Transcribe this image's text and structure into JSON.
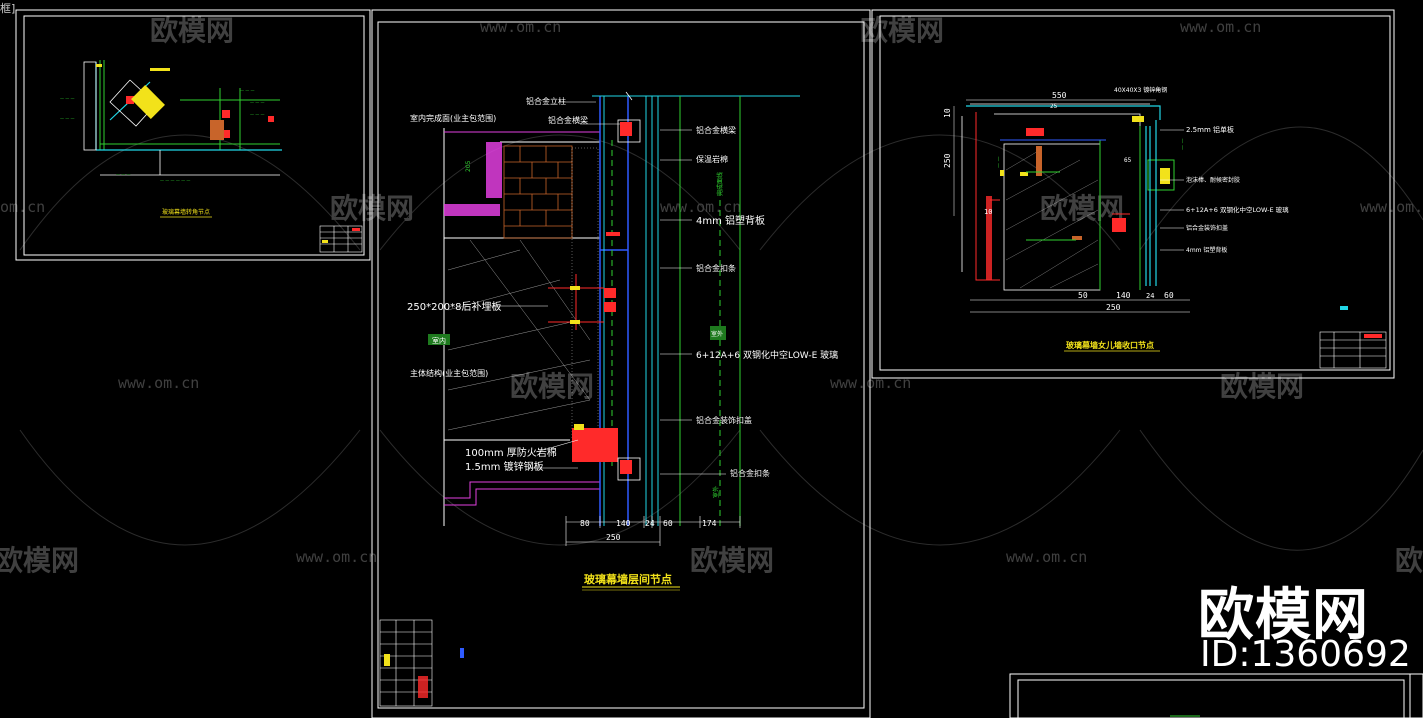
{
  "corner_tag": "框]",
  "watermark": {
    "brand": "欧模网",
    "url": "www.om.cn",
    "url_fragment": "om.cn",
    "big_brand": "欧模网",
    "big_id": "ID:1360692"
  },
  "colors": {
    "background": "#000000",
    "frame": "#ffffff",
    "yellow": "#f2e21a",
    "green": "#2fd12f",
    "cyan": "#21d6e6",
    "magenta": "#e23fe0",
    "red": "#ff2a2a",
    "orange": "#c8642a",
    "blue": "#2f5bff"
  },
  "sheet_left": {
    "title": "玻璃幕墙转角节点"
  },
  "sheet_center": {
    "title": "玻璃幕墙层间节点",
    "labels": {
      "aluminum_mullion": "铝合金立柱",
      "interior_ceiling": "室内完成面(业主包范围)",
      "aluminum_beam": "铝合金横梁",
      "aluminum_bracket": "铝合金横梁",
      "insulation_rock": "保温岩棉",
      "steel_sheet_4mm": "4mm 铝塑背板",
      "aluminum_profile": "铝合金扣条",
      "embed_plate": "250*200*8后补埋板",
      "indoor": "室内",
      "glass": "6+12A+6 双钢化中空LOW-E 玻璃",
      "main_structure": "主体结构(业主包范围)",
      "aluminum_cover": "铝合金装饰扣盖",
      "fire_rock": "100mm 厚防火岩棉",
      "steel_sheet_15": "1.5mm 镀锌钢板",
      "aluminum_trim": "铝合金扣条",
      "outdoor": "室外",
      "outdoor2": "室外",
      "finish": "完成面线",
      "dim_205": "205"
    },
    "dims": [
      "80",
      "140",
      "24",
      "60",
      "174",
      "250"
    ]
  },
  "sheet_right": {
    "title": "玻璃幕墙女儿墙收口节点",
    "labels": {
      "angle_steel": "40X40X3 镀锌角钢",
      "sheet_25": "2.5mm 铝单板",
      "sealant": "泡沫棒、耐候密封胶",
      "glass": "6+12A+6 双钢化中空LOW-E 玻璃",
      "aluminum_beam": "铝合金装饰扣盖",
      "sheet_4": "4mm 铝塑背板"
    },
    "dims_top": [
      "550",
      "25"
    ],
    "dims_left": [
      "10",
      "250",
      "10"
    ],
    "dims_bottom": [
      "50",
      "140",
      "24",
      "60",
      "250"
    ],
    "dim_small": "65"
  }
}
